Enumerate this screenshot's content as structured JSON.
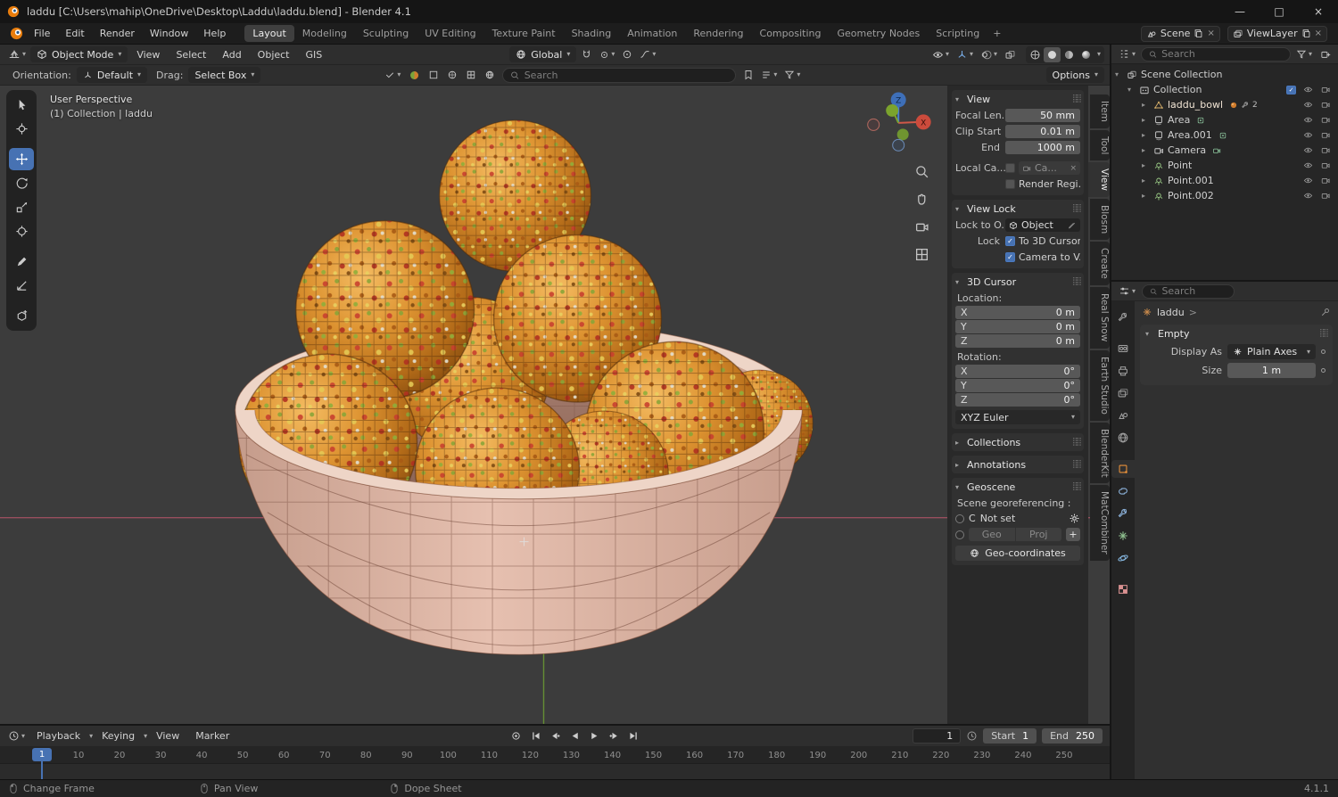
{
  "glyphs": {
    "caret_down": "▾",
    "chevron_right": "▸",
    "chevron_down": "▾",
    "check": "✓",
    "grip": "⣿⣿",
    "close": "×",
    "minimize": "—",
    "maximize": "□",
    "breadcrumb_sep": ">",
    "plus": "+"
  },
  "titlebar": {
    "title": "laddu [C:\\Users\\mahip\\OneDrive\\Desktop\\Laddu\\laddu.blend] - Blender 4.1"
  },
  "topbar": {
    "menus": [
      "File",
      "Edit",
      "Render",
      "Window",
      "Help"
    ],
    "workspaces": [
      "Layout",
      "Modeling",
      "Sculpting",
      "UV Editing",
      "Texture Paint",
      "Shading",
      "Animation",
      "Rendering",
      "Compositing",
      "Geometry Nodes",
      "Scripting"
    ],
    "add_workspace": "+",
    "scene_selector": {
      "value": "Scene"
    },
    "view_layer_selector": {
      "value": "ViewLayer"
    }
  },
  "viewport": {
    "header": {
      "mode": "Object Mode",
      "menus": [
        "View",
        "Select",
        "Add",
        "Object",
        "GIS"
      ],
      "orientation": "Global"
    },
    "tool_settings": {
      "orientation_label": "Orientation:",
      "orientation_value": "Default",
      "drag_label": "Drag:",
      "drag_value": "Select Box",
      "search_placeholder": "Search",
      "options_label": "Options"
    },
    "overlay": {
      "line1": "User Perspective",
      "line2": "(1) Collection | laddu"
    },
    "gizmo_axes": {
      "x": "X",
      "z": "Z"
    }
  },
  "npanel": {
    "tabs": [
      "Item",
      "Tool",
      "View",
      "Blosm",
      "Create",
      "Real Snow",
      "Earth Studio",
      "BlenderKit",
      "MatCombiner"
    ],
    "view": {
      "title": "View",
      "focal_label": "Focal Len...",
      "focal_value": "50 mm",
      "clip_start_label": "Clip Start",
      "clip_start_value": "0.01 m",
      "clip_end_label": "End",
      "clip_end_value": "1000 m",
      "local_camera_label": "Local Ca...",
      "local_camera_value": "Ca...",
      "render_region_label": "Render Regi..."
    },
    "view_lock": {
      "title": "View Lock",
      "lock_to_label": "Lock to O...",
      "lock_to_value": "Object",
      "lock_label": "Lock",
      "to_3d_cursor": "To 3D Cursor",
      "camera_to_view": "Camera to V..."
    },
    "cursor": {
      "title": "3D Cursor",
      "location_label": "Location:",
      "rotation_label": "Rotation:",
      "location": [
        {
          "axis": "X",
          "value": "0 m"
        },
        {
          "axis": "Y",
          "value": "0 m"
        },
        {
          "axis": "Z",
          "value": "0 m"
        }
      ],
      "rotation": [
        {
          "axis": "X",
          "value": "0°"
        },
        {
          "axis": "Y",
          "value": "0°"
        },
        {
          "axis": "Z",
          "value": "0°"
        }
      ],
      "rotation_mode": "XYZ Euler"
    },
    "collections_title": "Collections",
    "annotations_title": "Annotations",
    "geoscene": {
      "title": "Geoscene",
      "georeferencing_label": "Scene georeferencing :",
      "crs_prefix": "C",
      "crs_value": "Not set",
      "geo_label": "Geo",
      "proj_label": "Proj",
      "add_label": "+",
      "geo_coordinates_label": "Geo-coordinates"
    }
  },
  "outliner": {
    "search_placeholder": "Search",
    "scene_collection": "Scene Collection",
    "collection": "Collection",
    "items": [
      {
        "name": "laddu_bowl",
        "badge": "2"
      },
      {
        "name": "Area"
      },
      {
        "name": "Area.001"
      },
      {
        "name": "Camera"
      },
      {
        "name": "Point"
      },
      {
        "name": "Point.001"
      },
      {
        "name": "Point.002"
      }
    ]
  },
  "properties": {
    "search_placeholder": "Search",
    "breadcrumb": "laddu",
    "empty": {
      "title": "Empty",
      "display_as_label": "Display As",
      "display_as_value": "Plain Axes",
      "size_label": "Size",
      "size_value": "1 m"
    }
  },
  "timeline": {
    "menus": [
      "Playback",
      "Keying",
      "View",
      "Marker"
    ],
    "current_frame": "1",
    "playhead": "1",
    "start_label": "Start",
    "start_value": "1",
    "end_label": "End",
    "end_value": "250",
    "ticks": [
      10,
      20,
      30,
      40,
      50,
      60,
      70,
      80,
      90,
      100,
      110,
      120,
      130,
      140,
      150,
      160,
      170,
      180,
      190,
      200,
      210,
      220,
      230,
      240,
      250
    ]
  },
  "statusbar": {
    "hints": [
      {
        "label": "Change Frame"
      },
      {
        "label": "Pan View"
      },
      {
        "label": "Dope Sheet"
      }
    ],
    "version": "4.1.1"
  },
  "colors": {
    "accent_blue": "#4772b3",
    "laddu_orange": "#d98a2b",
    "bowl_pink": "#e6c0b0"
  }
}
